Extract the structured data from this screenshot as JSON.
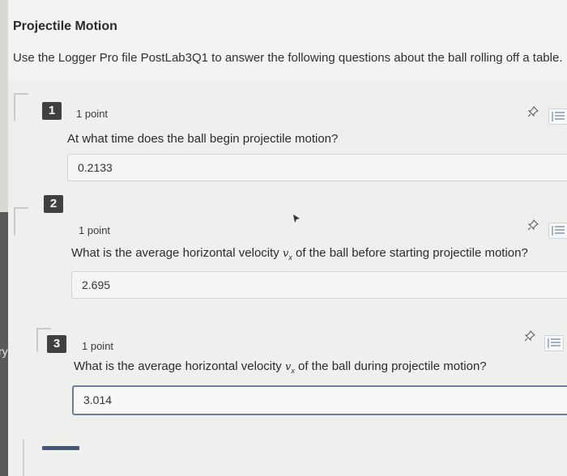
{
  "header": {
    "title": "Projectile Motion",
    "subtitle": "Use the Logger Pro file PostLab3Q1 to answer the following questions about the ball rolling off a table."
  },
  "side": {
    "cut_text": "ry"
  },
  "questions": [
    {
      "number": "1",
      "points": "1 point",
      "text": "At what time does the ball begin projectile motion?",
      "answer": "0.2133"
    },
    {
      "number": "2",
      "points": "1 point",
      "text_before": "What is the average horizontal velocity ",
      "symbol": "v",
      "subscript": "x",
      "text_after": " of the ball before starting projectile motion?",
      "answer": "2.695"
    },
    {
      "number": "3",
      "points": "1 point",
      "text_before": "What is the average horizontal velocity ",
      "symbol": "v",
      "subscript": "x",
      "text_after": " of the ball during projectile motion?",
      "answer": "3.014"
    }
  ],
  "icons": {
    "pin": "pin-icon",
    "menu": "list-menu-icon",
    "cursor": "mouse-cursor-icon"
  },
  "colors": {
    "number_badge": "#404040",
    "active_border": "#6a7e9a",
    "bottom_bar": "#43577a"
  }
}
